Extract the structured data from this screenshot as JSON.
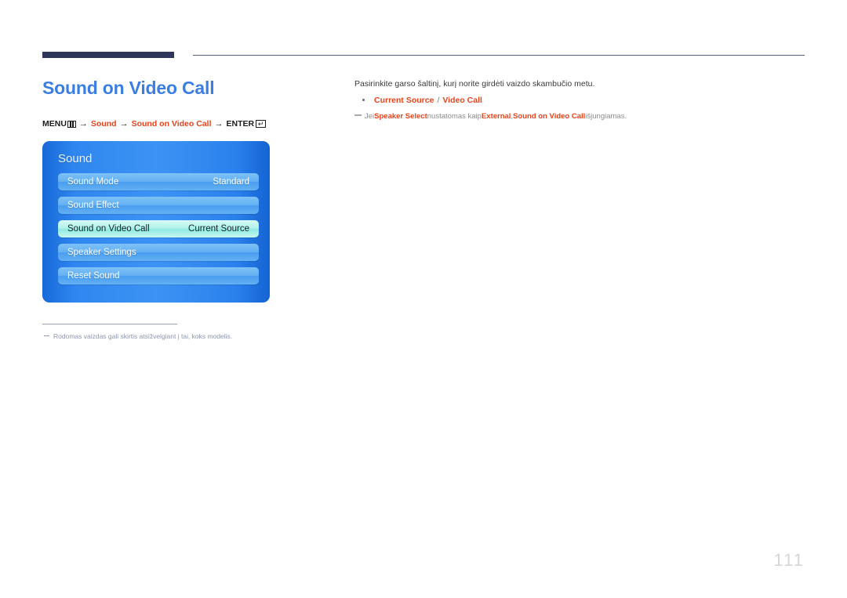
{
  "header": {
    "title": "Sound on Video Call",
    "title_color": "#3b7ee3",
    "rule_color": "#2e3558"
  },
  "breadcrumb": {
    "menu_label": "MENU",
    "menu_icon": "menu-bars-icon",
    "arrow": "→",
    "step1": "Sound",
    "step2": "Sound on Video Call",
    "enter_label": "ENTER",
    "enter_icon": "enter-return-icon",
    "enter_glyph": "↵",
    "accent_color": "#e8431a"
  },
  "osd": {
    "panel_title": "Sound",
    "rows": [
      {
        "label": "Sound Mode",
        "value": "Standard",
        "selected": false
      },
      {
        "label": "Sound Effect",
        "value": "",
        "selected": false
      },
      {
        "label": "Sound on Video Call",
        "value": "Current Source",
        "selected": true
      },
      {
        "label": "Speaker Settings",
        "value": "",
        "selected": false
      },
      {
        "label": "Reset Sound",
        "value": "",
        "selected": false
      }
    ],
    "footnote": "Rodomas vaizdas gali skirtis atsižvelgiant į tai, koks modelis."
  },
  "content": {
    "description": "Pasirinkite garso šaltinį, kurį norite girdėti vaizdo skambučio metu.",
    "option_first": "Current Source",
    "option_separator": "/",
    "option_second": "Video Call",
    "note": {
      "prefix": "Jei ",
      "bold1": "Speaker Select",
      "middle1": " nustatomas kaip ",
      "bold2": "External",
      "middle2": ", ",
      "bold3": "Sound on Video Call",
      "suffix": " išjungiamas."
    }
  },
  "footer": {
    "page_number": "111"
  }
}
